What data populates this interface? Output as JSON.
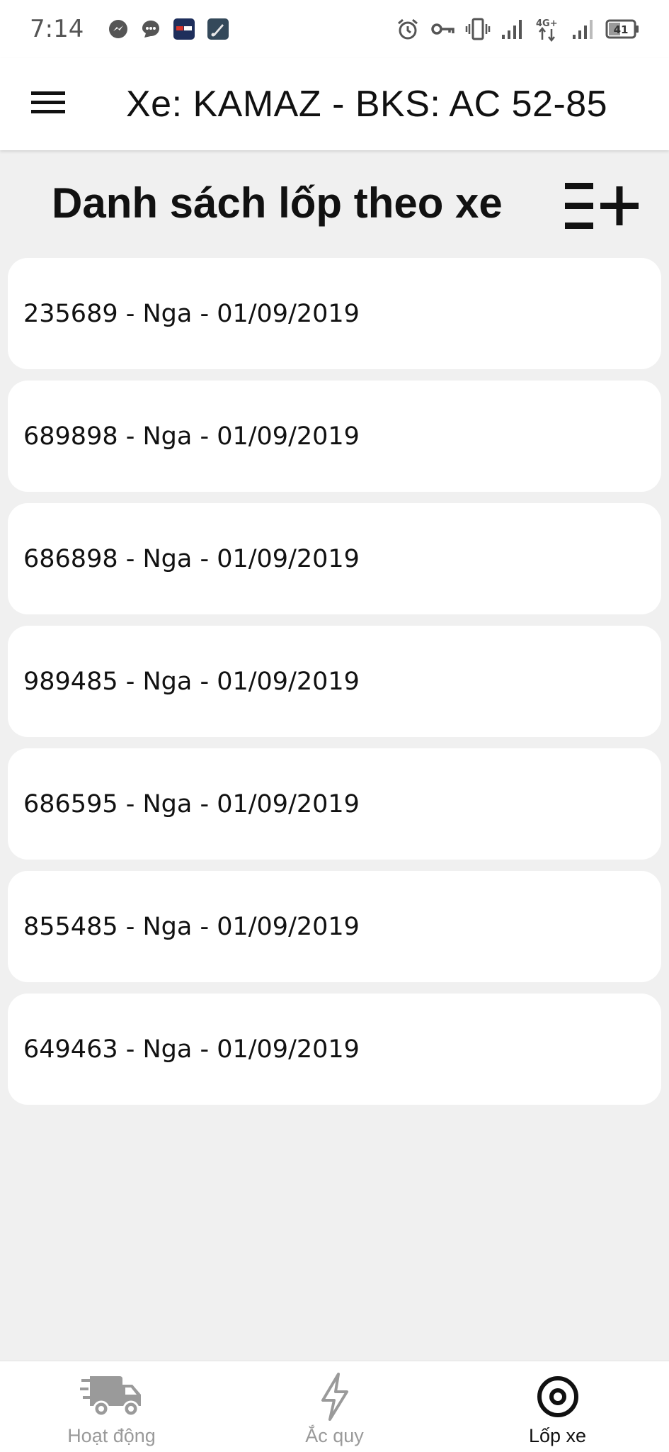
{
  "status_bar": {
    "time": "7:14",
    "battery_level": "41",
    "network_type": "4G+",
    "left_icons": [
      "messenger-icon",
      "chat-bubble-icon",
      "app-card-icon",
      "app-brush-icon"
    ],
    "right_icons": [
      "alarm-icon",
      "vpn-key-icon",
      "vibrate-icon",
      "signal-icon",
      "mobile-data-icon",
      "signal-icon",
      "battery-icon"
    ]
  },
  "app_bar": {
    "title": "Xe: KAMAZ - BKS: AC 52-85",
    "menu_icon": "hamburger-menu-icon"
  },
  "section": {
    "title": "Danh sách lốp theo xe",
    "add_icon": "playlist-add-icon"
  },
  "tyres": [
    {
      "label": "235689 - Nga - 01/09/2019"
    },
    {
      "label": "689898 - Nga - 01/09/2019"
    },
    {
      "label": "686898 - Nga - 01/09/2019"
    },
    {
      "label": "989485 - Nga - 01/09/2019"
    },
    {
      "label": "686595 - Nga - 01/09/2019"
    },
    {
      "label": "855485 - Nga - 01/09/2019"
    },
    {
      "label": "649463 - Nga - 01/09/2019"
    }
  ],
  "bottom_nav": {
    "items": [
      {
        "label": "Hoạt động",
        "icon": "delivery-truck-icon",
        "active": false
      },
      {
        "label": "Ắc quy",
        "icon": "lightning-bolt-icon",
        "active": false
      },
      {
        "label": "Lốp xe",
        "icon": "tyre-target-icon",
        "active": true
      }
    ]
  },
  "colors": {
    "background": "#f0f0f0",
    "surface": "#ffffff",
    "text_primary": "#111111",
    "nav_inactive": "#9a9a9a",
    "status_text": "#555555"
  }
}
